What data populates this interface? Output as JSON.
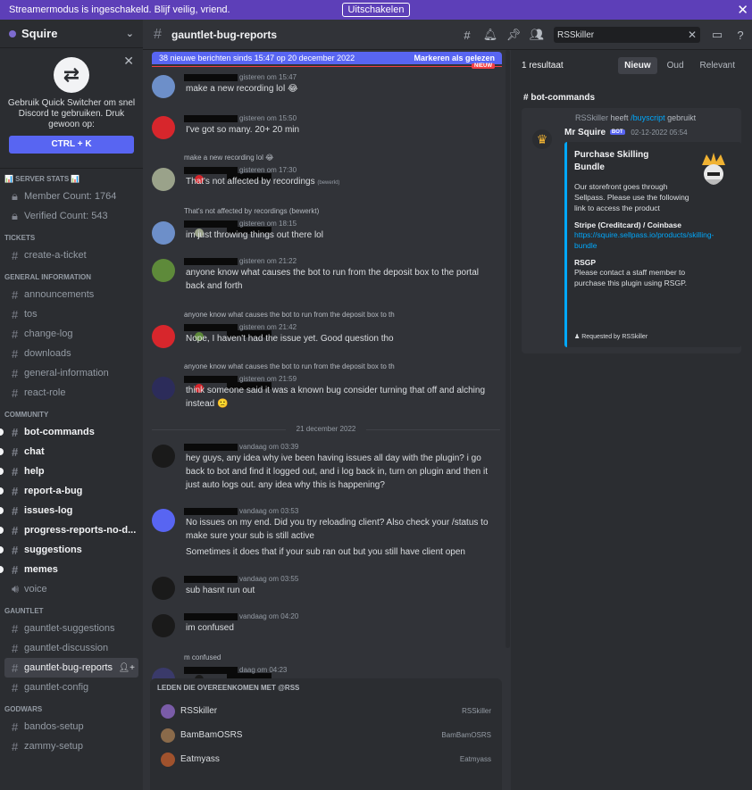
{
  "banner": {
    "message": "Streamermodus is ingeschakeld. Blijf veilig, vriend.",
    "button": "Uitschakelen"
  },
  "server": {
    "name": "Squire"
  },
  "quick_switcher": {
    "text": "Gebruik Quick Switcher om snel Discord te gebruiken. Druk gewoon op:",
    "shortcut": "CTRL + K"
  },
  "sidebar": {
    "categories": [
      {
        "label": "📊 SERVER STATS 📊",
        "channels": [
          {
            "label": "Member Count: 1764",
            "icon": "lock",
            "state": "normal"
          },
          {
            "label": "Verified Count: 543",
            "icon": "lock",
            "state": "normal"
          }
        ]
      },
      {
        "label": "TICKETS",
        "channels": [
          {
            "label": "create-a-ticket",
            "icon": "hash",
            "state": "normal"
          }
        ]
      },
      {
        "label": "GENERAL INFORMATION",
        "channels": [
          {
            "label": "announcements",
            "icon": "hash",
            "state": "normal"
          },
          {
            "label": "tos",
            "icon": "hash",
            "state": "normal"
          },
          {
            "label": "change-log",
            "icon": "hash",
            "state": "normal"
          },
          {
            "label": "downloads",
            "icon": "hash",
            "state": "normal"
          },
          {
            "label": "general-information",
            "icon": "hash",
            "state": "normal"
          },
          {
            "label": "react-role",
            "icon": "hash",
            "state": "normal"
          }
        ]
      },
      {
        "label": "COMMUNITY",
        "channels": [
          {
            "label": "bot-commands",
            "icon": "hash",
            "state": "unread"
          },
          {
            "label": "chat",
            "icon": "hash",
            "state": "unread"
          },
          {
            "label": "help",
            "icon": "hash",
            "state": "unread"
          },
          {
            "label": "report-a-bug",
            "icon": "hash",
            "state": "unread"
          },
          {
            "label": "issues-log",
            "icon": "hash",
            "state": "unread"
          },
          {
            "label": "progress-reports-no-d...",
            "icon": "hash",
            "state": "unread"
          },
          {
            "label": "suggestions",
            "icon": "hash",
            "state": "unread"
          },
          {
            "label": "memes",
            "icon": "hash",
            "state": "unread"
          },
          {
            "label": "voice",
            "icon": "speaker",
            "state": "normal"
          }
        ]
      },
      {
        "label": "GAUNTLET",
        "channels": [
          {
            "label": "gauntlet-suggestions",
            "icon": "hash",
            "state": "normal"
          },
          {
            "label": "gauntlet-discussion",
            "icon": "hash",
            "state": "normal"
          },
          {
            "label": "gauntlet-bug-reports",
            "icon": "hash",
            "state": "active"
          },
          {
            "label": "gauntlet-config",
            "icon": "hash",
            "state": "normal"
          }
        ]
      },
      {
        "label": "GODWARS",
        "channels": [
          {
            "label": "bandos-setup",
            "icon": "hash",
            "state": "normal"
          },
          {
            "label": "zammy-setup",
            "icon": "hash",
            "state": "normal"
          }
        ]
      }
    ]
  },
  "header": {
    "channel": "gauntlet-bug-reports",
    "search_value": "RSSkiller"
  },
  "new_messages": {
    "text": "38 nieuwe berichten sinds 15:47 op 20 december 2022",
    "mark_read": "Markeren als gelezen",
    "badge": "NIEUW"
  },
  "messages": [
    {
      "time": "gisteren om 15:47",
      "text": "make a new recording lol 😂",
      "reply": ""
    },
    {
      "time": "gisteren om 15:50",
      "text": "I've got so many. 20+ 20 min",
      "reply": ""
    },
    {
      "time": "gisteren om 17:30",
      "text": "That's not affected by recordings",
      "edited": "(bewerkt)",
      "reply": "make a new recording lol 😂"
    },
    {
      "time": "gisteren om 18:15",
      "text": "im just throwing things out there lol",
      "reply": "That's not affected by recordings (bewerkt)"
    },
    {
      "time": "gisteren om 21:22",
      "text": "anyone know what causes the bot to run from the deposit box to the portal back and forth",
      "reply": ""
    },
    {
      "time": "gisteren om 21:42",
      "text": "Nope, I haven't had the issue yet. Good question tho",
      "reply": "anyone know what causes the bot to run from the deposit box to th"
    },
    {
      "time": "gisteren om 21:59",
      "text": "think someone said it was a known bug consider turning that off and alching instead 🙁",
      "reply": "anyone know what causes the bot to run from the deposit box to th"
    },
    {
      "time": "vandaag om 03:39",
      "text": "hey guys, any idea why ive been having issues all day with the plugin? i go back to bot and find it logged out, and i log back in, turn on plugin and then it just auto logs out. any idea why this is happening?",
      "reply": ""
    },
    {
      "time": "vandaag om 03:53",
      "text": "No issues on my end. Did you try reloading client? Also check your /status to make sure your sub is still active",
      "text2": "Sometimes it does that if your sub ran out but you still have client open",
      "reply": ""
    },
    {
      "time": "vandaag om 03:55",
      "text": "sub hasnt run out",
      "reply": ""
    },
    {
      "time": "vandaag om 04:20",
      "text": "im confused",
      "reply": ""
    },
    {
      "time": "daag om 04:23",
      "text": "",
      "reply": "m confused"
    }
  ],
  "date_divider": "21 december 2022",
  "autocomplete": {
    "header": "LEDEN DIE OVEREENKOMEN MET @rss",
    "items": [
      {
        "name": "RSSkiller",
        "tag": "RSSkiller"
      },
      {
        "name": "BamBamOSRS",
        "tag": "BamBamOSRS"
      },
      {
        "name": "Eatmyass",
        "tag": "Eatmyass"
      }
    ]
  },
  "results": {
    "count": "1 resultaat",
    "tabs": [
      "Nieuw",
      "Oud",
      "Relevant"
    ],
    "active_tab": "Nieuw",
    "channel": "bot-commands",
    "command_user": "RSSkiller",
    "command_text": "heeft",
    "command": "/buyscript",
    "command_suffix": "gebruikt",
    "author": "Mr Squire",
    "bot_tag": "BOT",
    "date": "02-12-2022 05:54",
    "embed": {
      "title": "Purchase Skilling Bundle",
      "description": "Our storefront goes through Sellpass. Please use the following link to access the product",
      "field1_name": "Stripe (Creditcard) / Coinbase",
      "field1_value": "https://squire.sellpass.io/products/skilling-bundle",
      "field2_name": "RSGP",
      "field2_value": "Please contact a staff member to purchase this plugin using RSGP.",
      "footer": "Requested by RSSkiller"
    }
  }
}
